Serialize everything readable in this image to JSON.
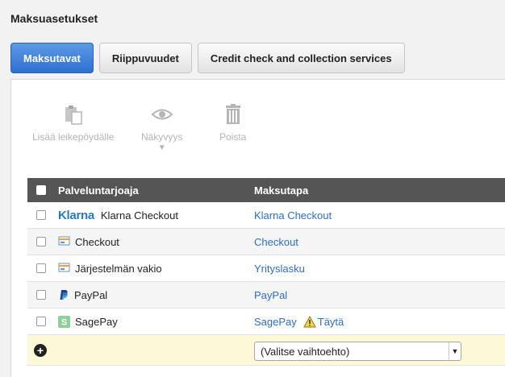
{
  "page_title": "Maksuasetukset",
  "tabs": [
    {
      "label": "Maksutavat",
      "active": true
    },
    {
      "label": "Riippuvuudet",
      "active": false
    },
    {
      "label": "Credit check and collection services",
      "active": false
    }
  ],
  "toolbar": {
    "copy_label": "Lisää leikepöydälle",
    "visibility_label": "Näkyvyys",
    "delete_label": "Poista"
  },
  "table": {
    "headers": [
      "Palveluntarjoaja",
      "Maksutapa"
    ],
    "rows": [
      {
        "provider": "Klarna Checkout",
        "provider_logo_text": "Klarna",
        "icon": "klarna-logo",
        "method": "Klarna Checkout"
      },
      {
        "provider": "Checkout",
        "icon": "card-icon",
        "method": "Checkout"
      },
      {
        "provider": "Järjestelmän vakio",
        "icon": "card-icon",
        "method": "Yrityslasku"
      },
      {
        "provider": "PayPal",
        "icon": "paypal-icon",
        "method": "PayPal"
      },
      {
        "provider": "SagePay",
        "icon": "sagepay-icon",
        "method": "SagePay",
        "warning": "Täytä"
      }
    ],
    "add_row": {
      "select_value": "(Valitse vaihtoehto)"
    }
  },
  "colors": {
    "accent": "#2f6fd0",
    "link": "#2d6fc6",
    "header_bg": "#555555",
    "add_row_bg": "#fdf8d8"
  }
}
